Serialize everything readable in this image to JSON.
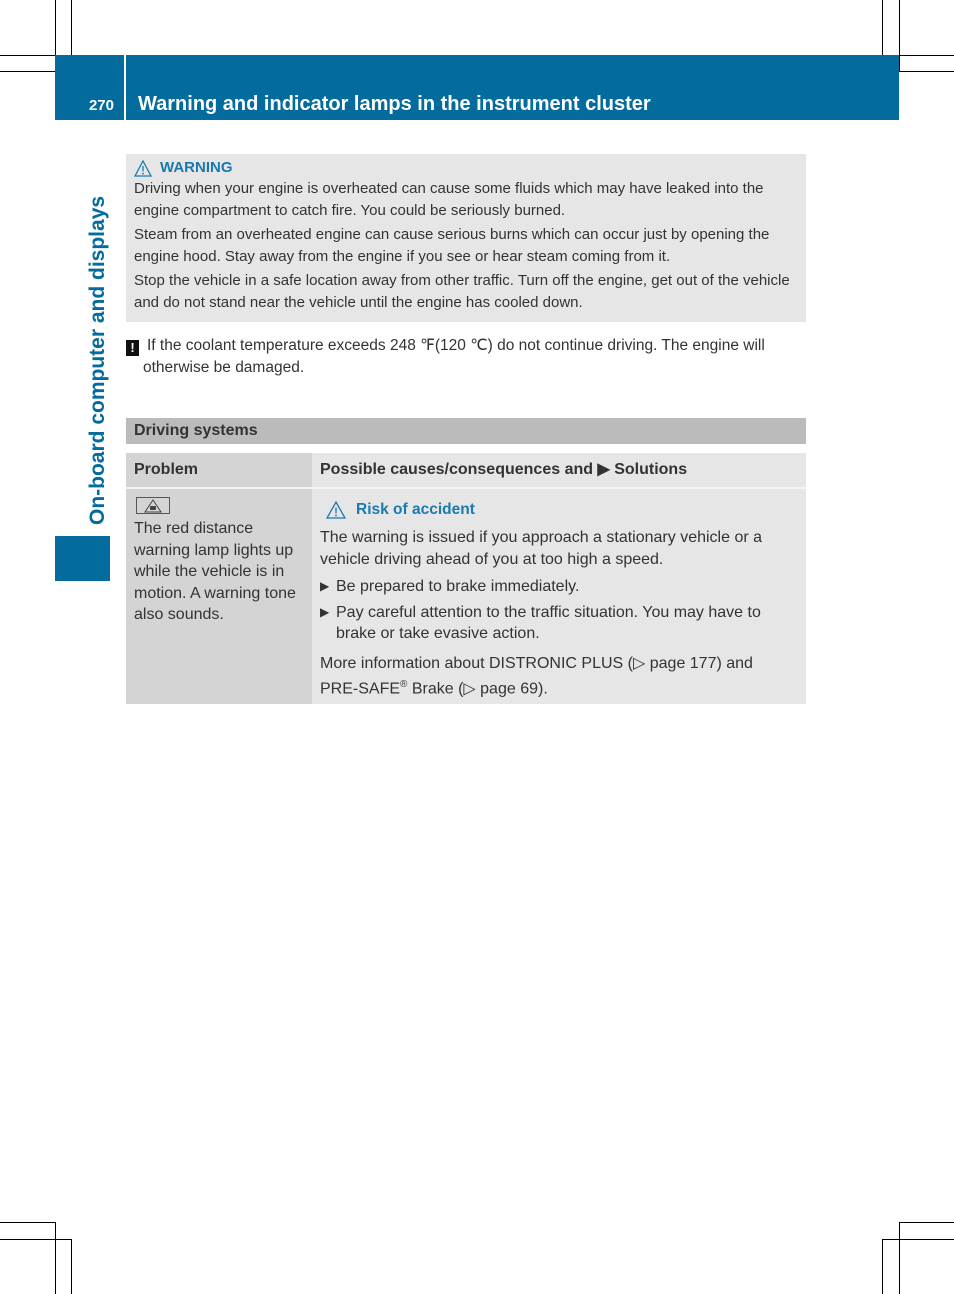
{
  "header": {
    "page_number": "270",
    "title": "Warning and indicator lamps in the instrument cluster"
  },
  "side_tab": {
    "title": "On-board computer and displays"
  },
  "warning_box": {
    "icon": "warning-triangle-icon",
    "label": "WARNING",
    "paragraphs": [
      "Driving when your engine is overheated can cause some fluids which may have leaked into the engine compartment to catch fire. You could be seriously burned.",
      "Steam from an overheated engine can cause serious burns which can occur just by opening the engine hood. Stay away from the engine if you see or hear steam coming from it.",
      "Stop the vehicle in a safe location away from other traffic. Turn off the engine, get out of the vehicle and do not stand near the vehicle until the engine has cooled down."
    ]
  },
  "note": {
    "icon": "exclamation-icon",
    "text_line1": "If the coolant temperature exceeds 248 ℉(120 ℃) do not continue driving. The engine will",
    "text_line2": "otherwise be damaged."
  },
  "section": {
    "title": "Driving systems",
    "table": {
      "col_problem": "Problem",
      "col_solutions": "Possible causes/consequences and ▶ Solutions",
      "rows": [
        {
          "problem_icon": "distance-warning-lamp-icon",
          "problem_text": "The red distance warning lamp lights up while the vehicle is in motion. A warning tone also sounds.",
          "risk_label": "Risk of accident",
          "description": "The warning is issued if you approach a stationary vehicle or a vehicle driving ahead of you at too high a speed.",
          "steps": [
            "Be prepared to brake immediately.",
            "Pay careful attention to the traffic situation. You may have to brake or take evasive action."
          ],
          "more_info_1": "More information about DISTRONIC PLUS (▷ page 177) and",
          "more_info_2a": "PRE-SAFE",
          "more_info_reg": "®",
          "more_info_2b": " Brake (▷ page 69)."
        }
      ]
    }
  }
}
